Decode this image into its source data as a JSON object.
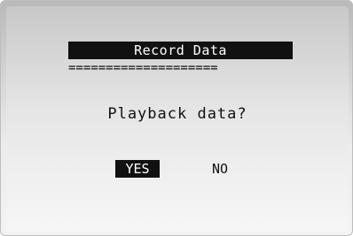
{
  "screen": {
    "title": "Record Data",
    "divider": "====================",
    "prompt": "Playback data?"
  },
  "options": [
    {
      "label": "YES",
      "selected": true
    },
    {
      "label": "NO",
      "selected": false
    }
  ],
  "colors": {
    "lcd_text": "#111111",
    "highlight_bg": "#111111",
    "highlight_text": "#ffffff",
    "screen_top": "#c8c8c8",
    "screen_bottom": "#f6f6f6"
  }
}
